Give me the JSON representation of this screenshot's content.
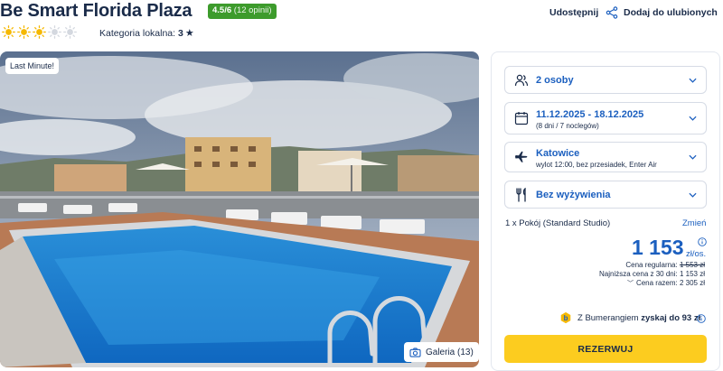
{
  "header": {
    "hotel_name": "Be Smart Florida Plaza",
    "rating_score": "4.5/6",
    "rating_count": "(12 opinii)",
    "suns_filled": 3,
    "suns_total": 5,
    "category_label": "Kategoria lokalna:",
    "category_value": "3",
    "share_label": "Udostępnij",
    "favorite_label": "Dodaj do ulubionych",
    "colors": {
      "rating_green": "#3d9b2c",
      "sun_yellow": "#f5b800",
      "sun_grey": "#d4d8df"
    }
  },
  "gallery": {
    "badge": "Last Minute!",
    "button_label": "Galeria (13)"
  },
  "booking": {
    "travelers": {
      "value": "2 osoby",
      "icon": "people-icon"
    },
    "dates": {
      "value": "11.12.2025 - 18.12.2025",
      "sub": "(8 dni / 7 noclegów)",
      "icon": "calendar-icon"
    },
    "departure": {
      "value": "Katowice",
      "sub": "wylot 12:00, bez przesiadek, Enter Air",
      "icon": "plane-icon"
    },
    "board": {
      "value": "Bez wyżywienia",
      "icon": "cutlery-icon"
    },
    "room_label": "1 x Pokój  (Standard Studio)",
    "change_label": "Zmień",
    "price": "1 153",
    "price_unit": "zł/os.",
    "regular_label": "Cena regularna:",
    "regular_value": "1 553 zł",
    "lowest_label": "Najniższa cena z 30 dni:",
    "lowest_value": "1 153 zł",
    "total_label": "Cena razem:",
    "total_value": "2 305 zł",
    "bumerang_prefix": "Z Bumerangiem",
    "bumerang_bold": "zyskaj do 93 zł",
    "reserve_label": "REZERWUJ",
    "colors": {
      "accent_blue": "#1b5fbf",
      "reserve_yellow": "#fccc1f"
    }
  }
}
